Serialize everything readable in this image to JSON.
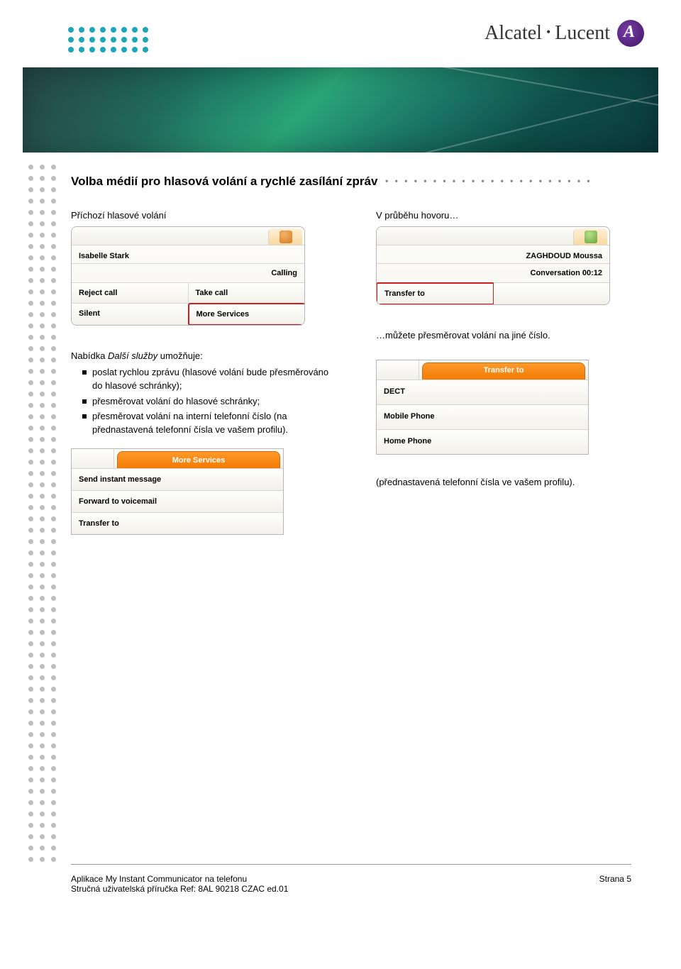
{
  "brand": {
    "name1": "Alcatel",
    "name2": "Lucent"
  },
  "title": "Volba médií pro hlasová volání a rychlé zasílání zpráv",
  "cols": {
    "left_label": "Příchozí hlasové volání",
    "right_label": "V průběhu hovoru…"
  },
  "incoming": {
    "caller": "Isabelle Stark",
    "status": "Calling",
    "reject": "Reject call",
    "take": "Take call",
    "silent": "Silent",
    "more": "More Services"
  },
  "conversation": {
    "caller": "ZAGHDOUD Moussa",
    "status": "Conversation 00:12",
    "transfer": "Transfer to"
  },
  "menu_intro": "Nabídka Další služby umožňuje:",
  "menu_italic": "Další služby",
  "menu_items": [
    "poslat rychlou zprávu (hlasové volání bude přesměrováno do hlasové schránky);",
    "přesměrovat volání do hlasové schránky;",
    "přesměrovat volání na interní telefonní číslo (na přednastavená telefonní čísla ve vašem profilu)."
  ],
  "more_services": {
    "tab": "More Services",
    "items": [
      "Send instant message",
      "Forward to voicemail",
      "Transfer to"
    ]
  },
  "right_text1": "…můžete přesměrovat volání na jiné číslo.",
  "transfer_to": {
    "tab": "Transfer to",
    "items": [
      "DECT",
      "Mobile Phone",
      "Home Phone"
    ]
  },
  "right_text2": "(přednastavená telefonní čísla ve vašem profilu).",
  "footer": {
    "line1": "Aplikace My Instant Communicator na telefonu",
    "line2": "Stručná uživatelská příručka Ref: 8AL 90218 CZAC ed.01",
    "page": "Strana 5"
  }
}
